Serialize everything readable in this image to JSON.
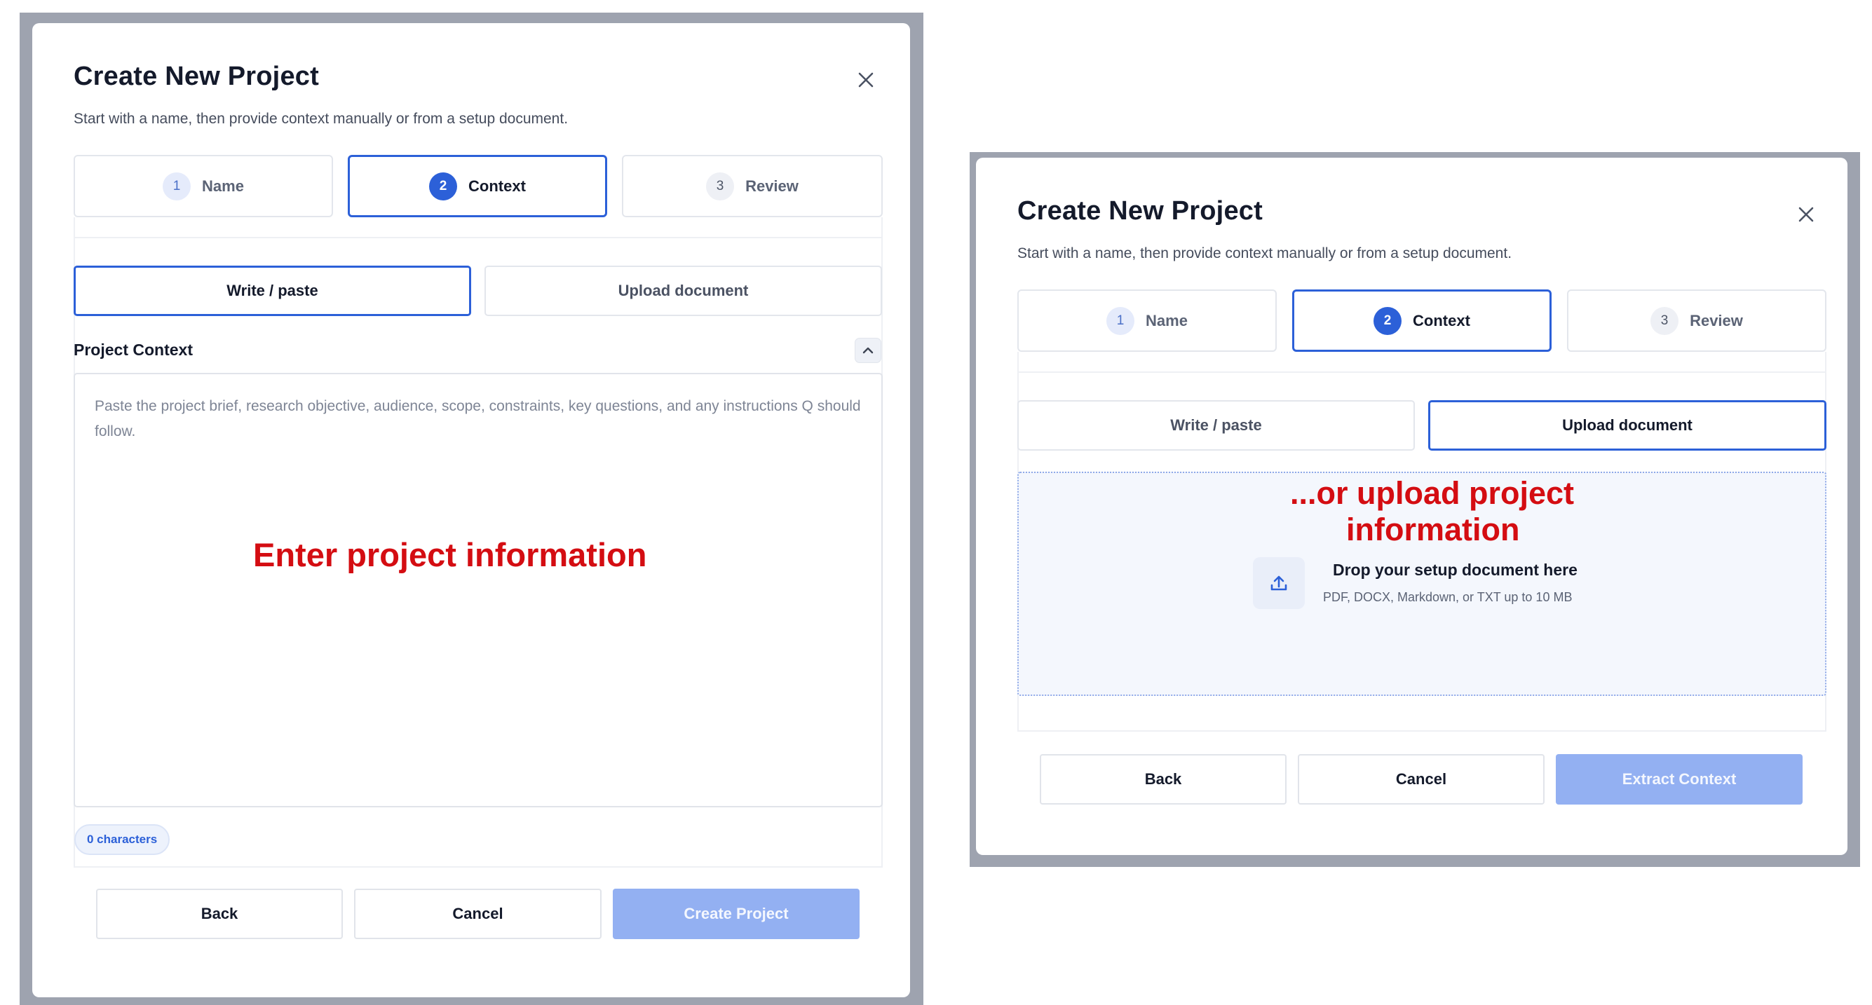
{
  "left_dialog": {
    "title": "Create New Project",
    "subtitle": "Start with a name, then provide context manually or from a setup document.",
    "close_icon": "close-icon",
    "steps": [
      {
        "number": "1",
        "label": "Name",
        "state": "completed"
      },
      {
        "number": "2",
        "label": "Context",
        "state": "active"
      },
      {
        "number": "3",
        "label": "Review",
        "state": "upcoming"
      }
    ],
    "mode_tabs": {
      "write": "Write / paste",
      "upload": "Upload document",
      "selected": "Write / paste"
    },
    "context_label": "Project Context",
    "collapse_icon": "chevron-up-icon",
    "textarea_placeholder": "Paste the project brief, research objective, audience, scope, constraints, key questions, and any instructions Q should follow.",
    "annotation": "Enter project information",
    "char_count": "0 characters",
    "buttons": {
      "back": "Back",
      "cancel": "Cancel",
      "create": "Create Project"
    }
  },
  "right_dialog": {
    "title": "Create New Project",
    "subtitle": "Start with a name, then provide context manually or from a setup document.",
    "close_icon": "close-icon",
    "steps": [
      {
        "number": "1",
        "label": "Name",
        "state": "completed"
      },
      {
        "number": "2",
        "label": "Context",
        "state": "active"
      },
      {
        "number": "3",
        "label": "Review",
        "state": "upcoming"
      }
    ],
    "mode_tabs": {
      "write": "Write / paste",
      "upload": "Upload document",
      "selected": "Upload document"
    },
    "annotation_line1": "...or upload project",
    "annotation_line2": "information",
    "upload_icon": "upload-icon",
    "drop_title": "Drop your setup document here",
    "drop_hint": "PDF, DOCX, Markdown, or TXT up to 10 MB",
    "buttons": {
      "back": "Back",
      "cancel": "Cancel",
      "extract": "Extract Context"
    }
  },
  "colors": {
    "accent": "#2c60d8",
    "primary_disabled": "#93b0f2",
    "annotation_red": "#d40d12",
    "backdrop": "#9ea3af"
  }
}
